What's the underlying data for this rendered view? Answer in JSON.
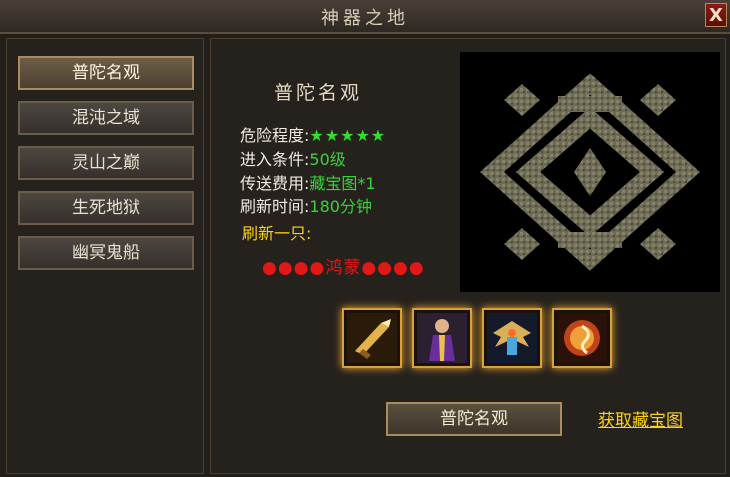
{
  "window": {
    "title": "神器之地",
    "close_label": "X"
  },
  "nav": {
    "items": [
      {
        "label": "普陀名观",
        "active": true
      },
      {
        "label": "混沌之域",
        "active": false
      },
      {
        "label": "灵山之巅",
        "active": false
      },
      {
        "label": "生死地狱",
        "active": false
      },
      {
        "label": "幽冥鬼船",
        "active": false
      }
    ]
  },
  "info": {
    "map_name": "普陀名观",
    "danger_label": "危险程度:",
    "danger_stars": "★★★★★",
    "entry_label": "进入条件:",
    "entry_value": "50级",
    "cost_label": "传送费用:",
    "cost_value": "藏宝图*1",
    "refresh_label": "刷新时间:",
    "refresh_value": "180分钟",
    "spawn_label": "刷新一只:",
    "boss_text": "●●●●鸿蒙●●●●"
  },
  "rewards": [
    {
      "icon": "golden-blade-icon"
    },
    {
      "icon": "robed-figure-icon"
    },
    {
      "icon": "winged-armor-icon"
    },
    {
      "icon": "fire-orb-icon"
    }
  ],
  "actions": {
    "go_label": "普陀名观",
    "get_map_label": "获取藏宝图"
  },
  "colors": {
    "accent_green": "#3bd23b",
    "accent_yellow": "#ffd21a",
    "boss_red": "#e01818"
  }
}
